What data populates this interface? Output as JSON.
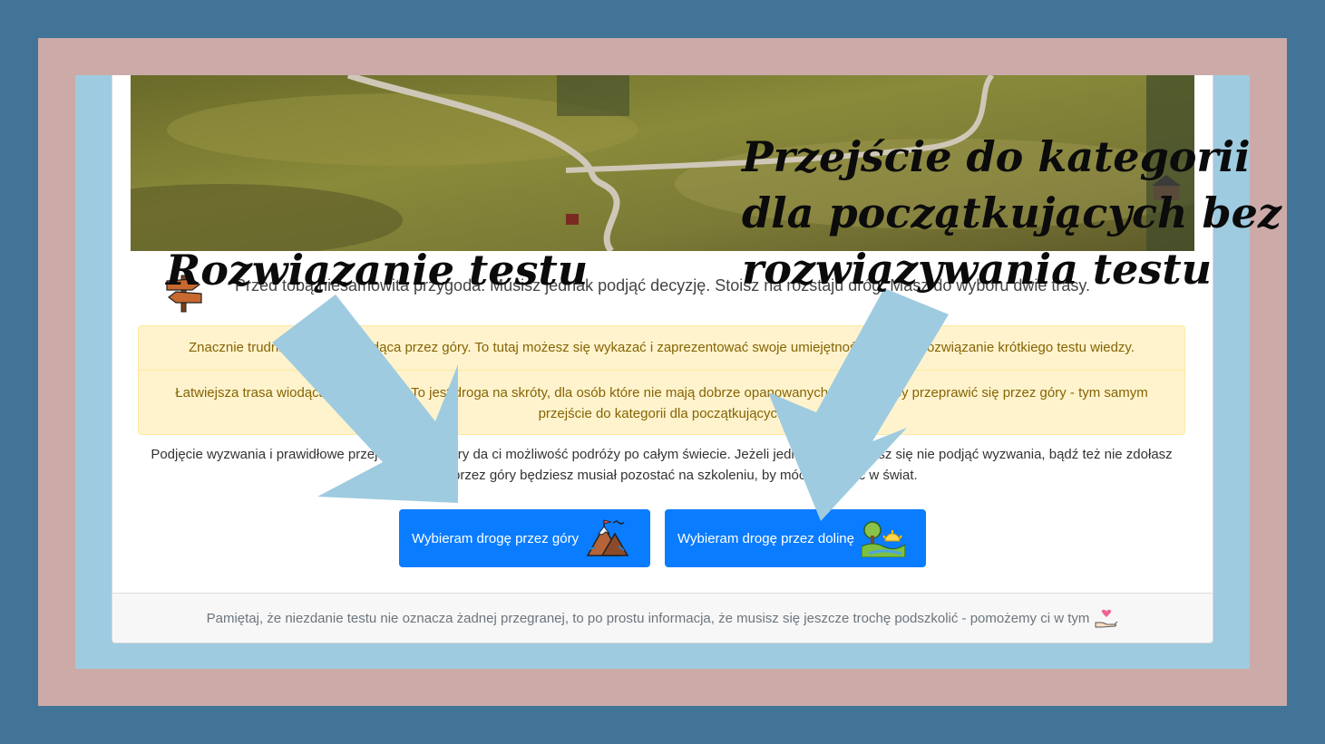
{
  "intro_text": "Przed tobą niesamowita przygoda. Musisz jednak podjąć decyzję. Stoisz na rozstaju dróg. Masz do wyboru dwie trasy.",
  "alert": {
    "mountain_route": "Znacznie trudniejsza trasa wiodąca przez góry. To tutaj możesz się wykazać i zaprezentować swoje umiejętności poprzez rozwiązanie krótkiego testu wiedzy.",
    "valley_route": "Łatwiejsza trasa wiodąca przez dolinę. To jest droga na skróty, dla osób które nie mają dobrze opanowanych podstaw aby przeprawić się przez góry - tym samym przejście do kategorii dla początkujących"
  },
  "note_text": "Podjęcie wyzwania i prawidłowe przejście przez góry da ci możliwość podróży po całym świecie. Jeżeli jednak zdecydujesz się nie podjąć wyzwania, bądź też nie zdołasz przejść przez góry będziesz musiał pozostać na szkoleniu, by móc wyruszyć w świat.",
  "buttons": {
    "mountains_label": "Wybieram drogę przez góry",
    "mountains_icon": "mountain-icon",
    "valley_label": "Wybieram drogę przez dolinę",
    "valley_icon": "valley-icon"
  },
  "footer_text": "Pamiętaj, że niezdanie testu nie oznacza żadnej przegranej, to po prostu informacja, że musisz się jeszcze trochę podszkolić - pomożemy ci w tym",
  "footer_icon": "helping-hand-heart-icon",
  "annotations": {
    "left": "Rozwiązanie testu",
    "right": "Przejście do kategorii dla początkujących bez rozwiązywania testu"
  },
  "colors": {
    "outer_background": "#417496",
    "pink_frame": "#cbaaa8",
    "blue_frame": "#9ecbe0",
    "button": "#0a7cff",
    "alert_background": "#fff3cd",
    "alert_text": "#856404",
    "arrow": "#9ecbe0"
  }
}
